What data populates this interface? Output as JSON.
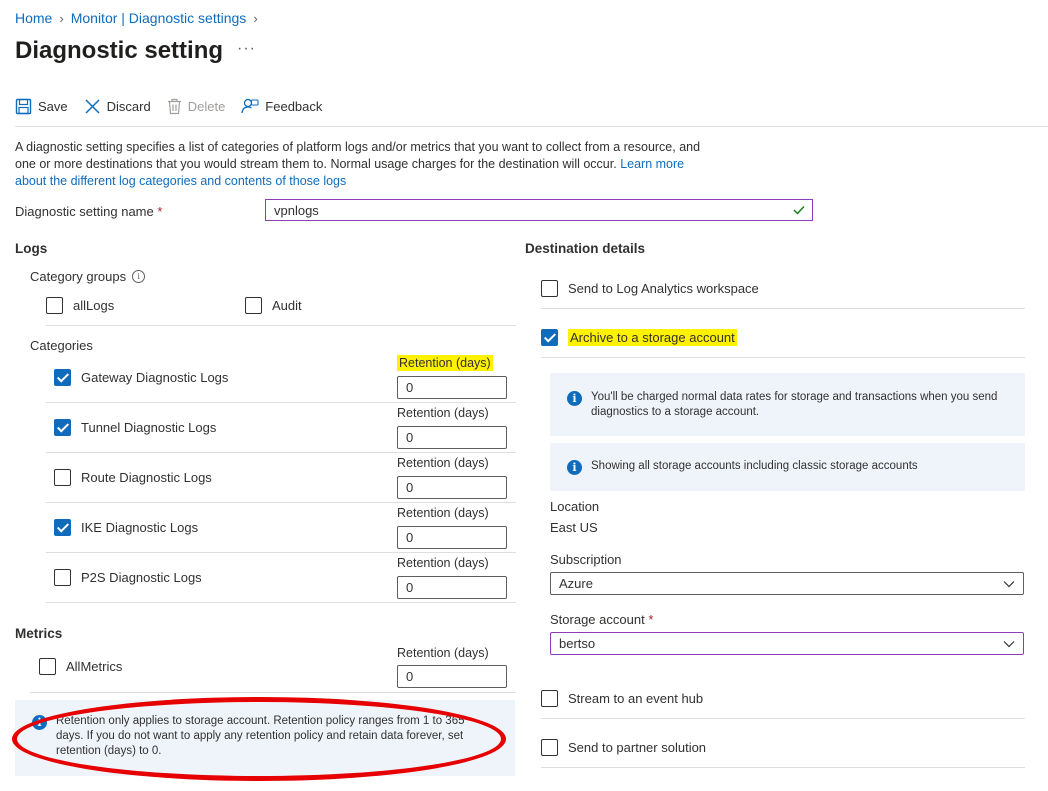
{
  "breadcrumb": {
    "items": [
      "Home",
      "Monitor | Diagnostic settings"
    ]
  },
  "page": {
    "title": "Diagnostic setting",
    "more": "···"
  },
  "toolbar": {
    "save": "Save",
    "discard": "Discard",
    "delete": "Delete",
    "feedback": "Feedback"
  },
  "description": {
    "text": "A diagnostic setting specifies a list of categories of platform logs and/or metrics that you want to collect from a resource, and one or more destinations that you would stream them to. Normal usage charges for the destination will occur.",
    "link": "Learn more about the different log categories and contents of those logs"
  },
  "setting_name": {
    "label": "Diagnostic setting name",
    "required_mark": "*",
    "value": "vpnlogs"
  },
  "logs": {
    "heading": "Logs",
    "category_groups_label": "Category groups",
    "groups": [
      {
        "label": "allLogs",
        "checked": false
      },
      {
        "label": "Audit",
        "checked": false
      }
    ],
    "categories_label": "Categories",
    "categories": [
      {
        "label": "Gateway Diagnostic Logs",
        "checked": true,
        "retention_label": "Retention (days)",
        "retention": "0"
      },
      {
        "label": "Tunnel Diagnostic Logs",
        "checked": true,
        "retention_label": "Retention (days)",
        "retention": "0"
      },
      {
        "label": "Route Diagnostic Logs",
        "checked": false,
        "retention_label": "Retention (days)",
        "retention": "0"
      },
      {
        "label": "IKE Diagnostic Logs",
        "checked": true,
        "retention_label": "Retention (days)",
        "retention": "0"
      },
      {
        "label": "P2S Diagnostic Logs",
        "checked": false,
        "retention_label": "Retention (days)",
        "retention": "0"
      }
    ]
  },
  "metrics": {
    "heading": "Metrics",
    "item": {
      "label": "AllMetrics",
      "checked": false,
      "retention_label": "Retention (days)",
      "retention": "0"
    }
  },
  "retention_info": "Retention only applies to storage account. Retention policy ranges from 1 to 365 days. If you do not want to apply any retention policy and retain data forever, set retention (days) to 0.",
  "destination": {
    "heading": "Destination details",
    "log_analytics": {
      "label": "Send to Log Analytics workspace",
      "checked": false
    },
    "storage": {
      "label": "Archive to a storage account",
      "checked": true
    },
    "info_charged": "You'll be charged normal data rates for storage and transactions when you send diagnostics to a storage account.",
    "info_classic": "Showing all storage accounts including classic storage accounts",
    "location_label": "Location",
    "location_value": "East US",
    "subscription_label": "Subscription",
    "subscription_value": "Azure",
    "storage_account_label": "Storage account",
    "storage_account_required": "*",
    "storage_account_value": "bertso",
    "event_hub": {
      "label": "Stream to an event hub",
      "checked": false
    },
    "partner": {
      "label": "Send to partner solution",
      "checked": false
    }
  },
  "colors": {
    "accent": "#0f6cbd",
    "highlight": "#fff200",
    "annotation_red": "#e60000",
    "focus_border": "#8a3dbb"
  }
}
